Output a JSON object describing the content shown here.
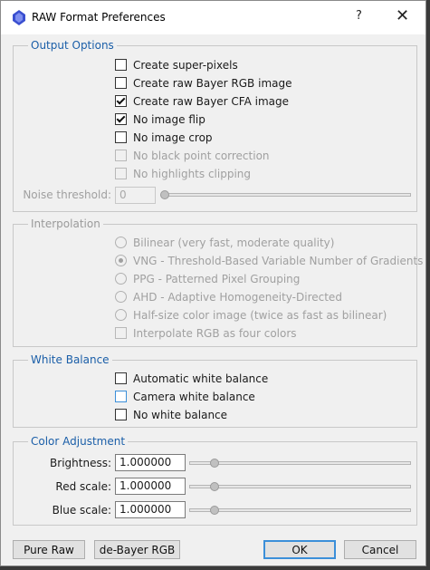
{
  "window": {
    "title": "RAW Format Preferences",
    "help_glyph": "?",
    "close_glyph": "✕"
  },
  "output_options": {
    "legend": "Output Options",
    "items": [
      {
        "label": "Create super-pixels",
        "checked": false,
        "enabled": true
      },
      {
        "label": "Create raw Bayer RGB image",
        "checked": false,
        "enabled": true
      },
      {
        "label": "Create raw Bayer CFA image",
        "checked": true,
        "enabled": true
      },
      {
        "label": "No image flip",
        "checked": true,
        "enabled": true
      },
      {
        "label": "No image crop",
        "checked": false,
        "enabled": true
      },
      {
        "label": "No black point correction",
        "checked": false,
        "enabled": false
      },
      {
        "label": "No highlights clipping",
        "checked": false,
        "enabled": false
      }
    ],
    "noise_threshold_label": "Noise threshold:",
    "noise_threshold_value": "0"
  },
  "interpolation": {
    "legend": "Interpolation",
    "options": [
      {
        "label": "Bilinear (very fast, moderate quality)",
        "selected": false
      },
      {
        "label": "VNG - Threshold-Based Variable Number of Gradients",
        "selected": true
      },
      {
        "label": "PPG - Patterned Pixel Grouping",
        "selected": false
      },
      {
        "label": "AHD - Adaptive Homogeneity-Directed",
        "selected": false
      },
      {
        "label": "Half-size color image (twice as fast as bilinear)",
        "selected": false
      }
    ],
    "four_colors_label": "Interpolate RGB as four colors"
  },
  "white_balance": {
    "legend": "White Balance",
    "items": [
      {
        "label": "Automatic white balance",
        "checked": false
      },
      {
        "label": "Camera white balance",
        "checked": false
      },
      {
        "label": "No white balance",
        "checked": false
      }
    ]
  },
  "color_adjustment": {
    "legend": "Color Adjustment",
    "brightness_label": "Brightness:",
    "brightness_value": "1.000000",
    "red_label": "Red scale:",
    "red_value": "1.000000",
    "blue_label": "Blue scale:",
    "blue_value": "1.000000"
  },
  "buttons": {
    "pure_raw": "Pure Raw",
    "debayer_rgb": "de-Bayer RGB",
    "ok": "OK",
    "cancel": "Cancel"
  },
  "colors": {
    "legend_accent": "#1a5ea8",
    "focus_blue": "#3b8fd9"
  }
}
